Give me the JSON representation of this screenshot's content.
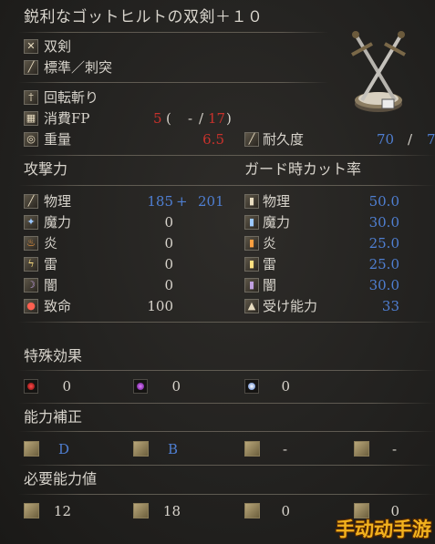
{
  "header": {
    "title": "鋭利なゴットヒルトの双剣＋１０"
  },
  "weapon": {
    "type": "双剣",
    "attack_type": "標準／刺突",
    "skill": "回転斬り",
    "fp_label": "消費FP",
    "fp_open": "(",
    "fp_main": "5",
    "fp_dash": "-",
    "fp_slash": "/",
    "fp_alt": "17",
    "fp_close": ")",
    "weight_label": "重量",
    "weight_value": "6.5",
    "durability_label": "耐久度",
    "durability_value": "70",
    "durability_max": "7"
  },
  "attack": {
    "heading": "攻撃力",
    "rows": [
      {
        "icon": "sword-icon",
        "label": "物理",
        "value": "185",
        "plus": "+",
        "bonus": "201"
      },
      {
        "icon": "magic-icon",
        "label": "魔力",
        "value": "0"
      },
      {
        "icon": "fire-icon",
        "label": "炎",
        "value": "0"
      },
      {
        "icon": "lightning-icon",
        "label": "雷",
        "value": "0"
      },
      {
        "icon": "dark-icon",
        "label": "闇",
        "value": "0"
      },
      {
        "icon": "critical-icon",
        "label": "致命",
        "value": "100"
      }
    ]
  },
  "guard": {
    "heading": "ガード時カット率",
    "rows": [
      {
        "icon": "shield-physical-icon",
        "label": "物理",
        "value": "50.0"
      },
      {
        "icon": "shield-magic-icon",
        "label": "魔力",
        "value": "30.0"
      },
      {
        "icon": "shield-fire-icon",
        "label": "炎",
        "value": "25.0"
      },
      {
        "icon": "shield-lightning-icon",
        "label": "雷",
        "value": "25.0"
      },
      {
        "icon": "shield-dark-icon",
        "label": "闇",
        "value": "30.0"
      },
      {
        "icon": "stability-icon",
        "label": "受け能力",
        "value": "33"
      }
    ]
  },
  "special_effects": {
    "heading": "特殊効果",
    "items": [
      {
        "icon": "bleed-icon",
        "value": "0"
      },
      {
        "icon": "poison-icon",
        "value": "0"
      },
      {
        "icon": "frost-icon",
        "value": "0"
      }
    ]
  },
  "scaling": {
    "heading": "能力補正",
    "items": [
      {
        "icon": "strength-icon",
        "value": "D"
      },
      {
        "icon": "dexterity-icon",
        "value": "B"
      },
      {
        "icon": "intelligence-icon",
        "value": "-"
      },
      {
        "icon": "faith-icon",
        "value": "-"
      }
    ]
  },
  "requirements": {
    "heading": "必要能力値",
    "items": [
      {
        "icon": "strength-icon",
        "value": "12"
      },
      {
        "icon": "dexterity-icon",
        "value": "18"
      },
      {
        "icon": "intelligence-icon",
        "value": "0"
      },
      {
        "icon": "faith-icon",
        "value": "0"
      }
    ]
  },
  "watermark": "手动动手游",
  "colors": {
    "blue": "#4f7fd2",
    "red": "#c8322c",
    "gold": "#f2b21e"
  }
}
